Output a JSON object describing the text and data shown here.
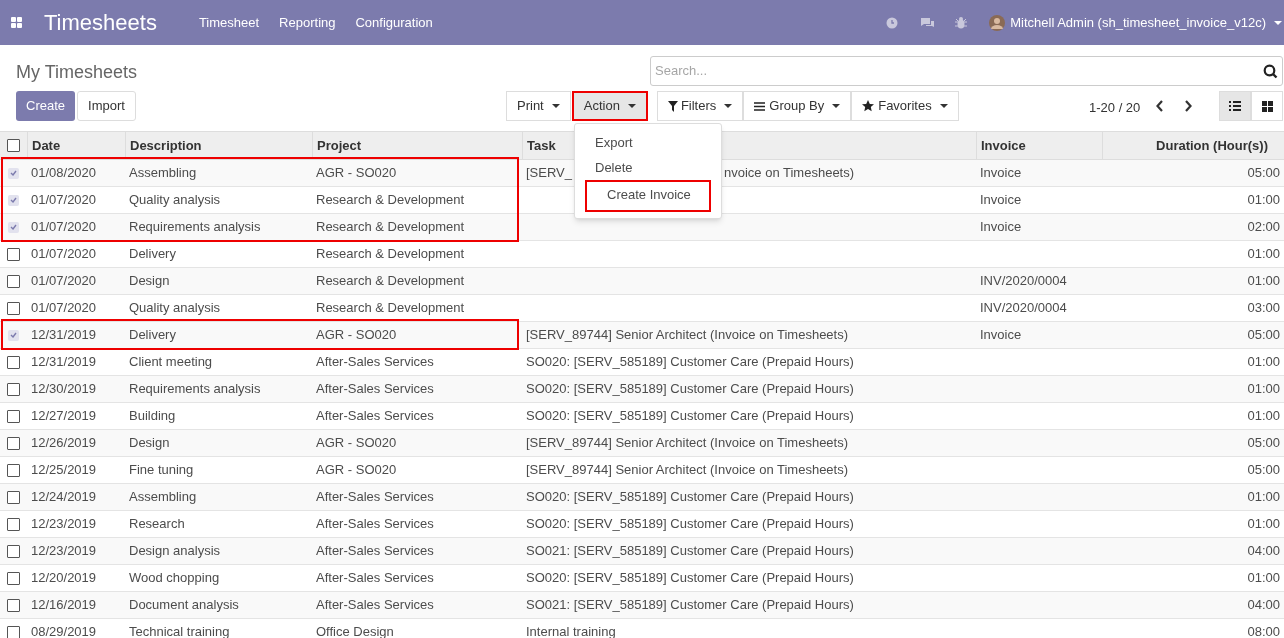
{
  "navbar": {
    "app_title": "Timesheets",
    "menus": [
      "Timesheet",
      "Reporting",
      "Configuration"
    ],
    "user": "Mitchell Admin (sh_timesheet_invoice_v12c)"
  },
  "breadcrumb": "My Timesheets",
  "buttons": [
    "Create",
    "Import"
  ],
  "search": {
    "placeholder": "Search..."
  },
  "dropdowns": [
    {
      "label": "Print",
      "kind": "plain",
      "highlighted": false
    },
    {
      "label": "Action",
      "kind": "plain",
      "highlighted": true,
      "open": true
    },
    {
      "label": "Filters",
      "kind": "filter",
      "highlighted": false
    },
    {
      "label": "Group By",
      "kind": "group",
      "highlighted": false
    },
    {
      "label": "Favorites",
      "kind": "star",
      "highlighted": false
    }
  ],
  "action_menu": [
    {
      "label": "Export",
      "highlighted": false
    },
    {
      "label": "Delete",
      "highlighted": false
    },
    {
      "label": "Create Invoice",
      "highlighted": true
    }
  ],
  "pager": "1-20 / 20",
  "views": [
    {
      "kind": "list",
      "selected": true
    },
    {
      "kind": "kanban",
      "selected": false
    }
  ],
  "table": {
    "all_selected": false,
    "columns": [
      "Date",
      "Description",
      "Project",
      "Task",
      "Invoice",
      "Duration (Hour(s))"
    ],
    "rows": [
      {
        "checked": true,
        "marked": true,
        "date": "01/08/2020",
        "description": "Assembling",
        "project": "AGR - SO020",
        "task": "[SERV_",
        "task_tail": "nvoice on Timesheets)",
        "invoice": "Invoice",
        "duration": "05:00"
      },
      {
        "checked": true,
        "marked": true,
        "date": "01/07/2020",
        "description": "Quality analysis",
        "project": "Research & Development",
        "invoice": "Invoice",
        "duration": "01:00"
      },
      {
        "checked": true,
        "marked": true,
        "date": "01/07/2020",
        "description": "Requirements analysis",
        "project": "Research & Development",
        "invoice": "Invoice",
        "duration": "02:00"
      },
      {
        "checked": false,
        "marked": false,
        "date": "01/07/2020",
        "description": "Delivery",
        "project": "Research & Development",
        "duration": "01:00"
      },
      {
        "checked": false,
        "marked": false,
        "date": "01/07/2020",
        "description": "Design",
        "project": "Research & Development",
        "invoice": "INV/2020/0004",
        "duration": "01:00"
      },
      {
        "checked": false,
        "marked": false,
        "date": "01/07/2020",
        "description": "Quality analysis",
        "project": "Research & Development",
        "invoice": "INV/2020/0004",
        "duration": "03:00"
      },
      {
        "checked": true,
        "marked": true,
        "date": "12/31/2019",
        "description": "Delivery",
        "project": "AGR - SO020",
        "task": "[SERV_89744] Senior Architect (Invoice on Timesheets)",
        "invoice": "Invoice",
        "duration": "05:00"
      },
      {
        "checked": false,
        "marked": false,
        "date": "12/31/2019",
        "description": "Client meeting",
        "project": "After-Sales Services",
        "task": "SO020: [SERV_585189] Customer Care (Prepaid Hours)",
        "duration": "01:00"
      },
      {
        "checked": false,
        "marked": false,
        "date": "12/30/2019",
        "description": "Requirements analysis",
        "project": "After-Sales Services",
        "task": "SO020: [SERV_585189] Customer Care (Prepaid Hours)",
        "duration": "01:00"
      },
      {
        "checked": false,
        "marked": false,
        "date": "12/27/2019",
        "description": "Building",
        "project": "After-Sales Services",
        "task": "SO020: [SERV_585189] Customer Care (Prepaid Hours)",
        "duration": "01:00"
      },
      {
        "checked": false,
        "marked": false,
        "date": "12/26/2019",
        "description": "Design",
        "project": "AGR - SO020",
        "task": "[SERV_89744] Senior Architect (Invoice on Timesheets)",
        "duration": "05:00"
      },
      {
        "checked": false,
        "marked": false,
        "date": "12/25/2019",
        "description": "Fine tuning",
        "project": "AGR - SO020",
        "task": "[SERV_89744] Senior Architect (Invoice on Timesheets)",
        "duration": "05:00"
      },
      {
        "checked": false,
        "marked": false,
        "date": "12/24/2019",
        "description": "Assembling",
        "project": "After-Sales Services",
        "task": "SO020: [SERV_585189] Customer Care (Prepaid Hours)",
        "duration": "01:00"
      },
      {
        "checked": false,
        "marked": false,
        "date": "12/23/2019",
        "description": "Research",
        "project": "After-Sales Services",
        "task": "SO020: [SERV_585189] Customer Care (Prepaid Hours)",
        "duration": "01:00"
      },
      {
        "checked": false,
        "marked": false,
        "date": "12/23/2019",
        "description": "Design analysis",
        "project": "After-Sales Services",
        "task": "SO021: [SERV_585189] Customer Care (Prepaid Hours)",
        "duration": "04:00"
      },
      {
        "checked": false,
        "marked": false,
        "date": "12/20/2019",
        "description": "Wood chopping",
        "project": "After-Sales Services",
        "task": "SO020: [SERV_585189] Customer Care (Prepaid Hours)",
        "duration": "01:00"
      },
      {
        "checked": false,
        "marked": false,
        "date": "12/16/2019",
        "description": "Document analysis",
        "project": "After-Sales Services",
        "task": "SO021: [SERV_585189] Customer Care (Prepaid Hours)",
        "duration": "04:00"
      },
      {
        "checked": false,
        "marked": false,
        "date": "08/29/2019",
        "description": "Technical training",
        "project": "Office Design",
        "task": "Internal training",
        "duration": "08:00"
      }
    ]
  }
}
